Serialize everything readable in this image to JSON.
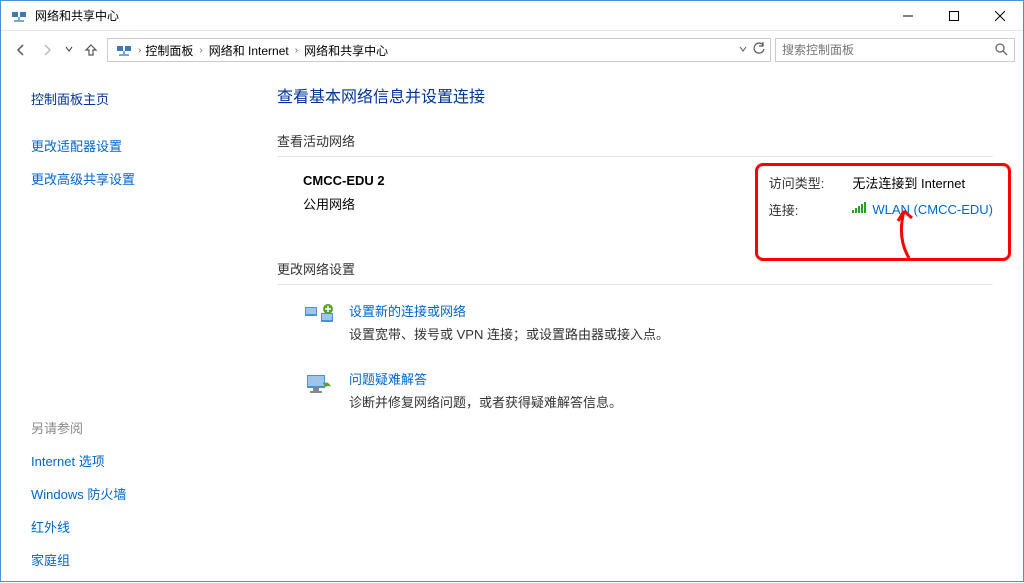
{
  "window": {
    "title": "网络和共享中心"
  },
  "breadcrumb": {
    "items": [
      "控制面板",
      "网络和 Internet",
      "网络和共享中心"
    ]
  },
  "search": {
    "placeholder": "搜索控制面板"
  },
  "sidebar": {
    "home": "控制面板主页",
    "links": [
      "更改适配器设置",
      "更改高级共享设置"
    ],
    "footer_head": "另请参阅",
    "footer_links": [
      "Internet 选项",
      "Windows 防火墙",
      "红外线",
      "家庭组"
    ]
  },
  "main": {
    "title": "查看基本网络信息并设置连接",
    "active_section": "查看活动网络",
    "network": {
      "name": "CMCC-EDU  2",
      "type": "公用网络",
      "access_label": "访问类型:",
      "access_value": "无法连接到 Internet",
      "conn_label": "连接:",
      "conn_value": "WLAN (CMCC-EDU)"
    },
    "change_section": "更改网络设置",
    "tasks": [
      {
        "link": "设置新的连接或网络",
        "desc": "设置宽带、拨号或 VPN 连接；或设置路由器或接入点。"
      },
      {
        "link": "问题疑难解答",
        "desc": "诊断并修复网络问题，或者获得疑难解答信息。"
      }
    ]
  }
}
